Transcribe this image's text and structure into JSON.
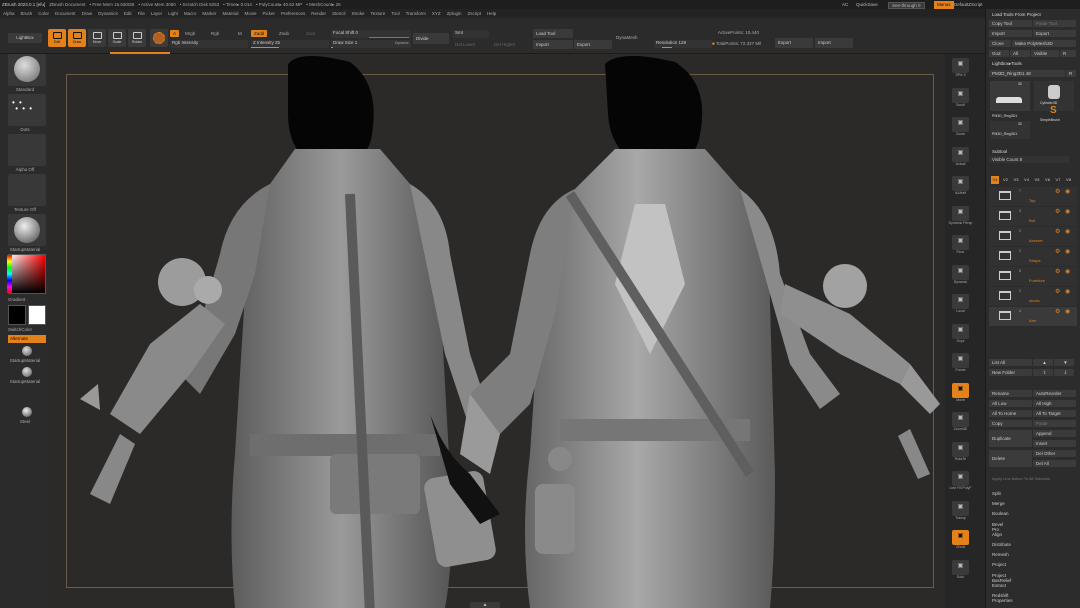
{
  "menubar": {
    "title": "ZBrush 2023.0.1 [efu]",
    "document": "ZBrush Document",
    "stats": [
      "• Free Mem 15.630GB",
      "• Active Mem 3050",
      "• Scratch Disk 8253",
      "• Timer▸ 0.014",
      "• PolyCount▸ 40.62 MP",
      "• MeshCount▸ 26"
    ],
    "ac": "AC",
    "quicksave": "QuickSave",
    "see_through": "See-through  0",
    "menus": "Menus",
    "script": "DefaultZScript",
    "menu_items": [
      "Alpha",
      "Brush",
      "Color",
      "Document",
      "Draw",
      "Dynamics",
      "Edit",
      "File",
      "Layer",
      "Light",
      "Macro",
      "Marker",
      "Material",
      "Movie",
      "Picker",
      "Preferences",
      "Render",
      "Stencil",
      "Stroke",
      "Texture",
      "Tool",
      "Transform",
      "XYZ",
      "Zplugin",
      "Zscript",
      "Help"
    ]
  },
  "shelf": {
    "lightbox": "LightBox",
    "tools": [
      {
        "label": "Edit",
        "active": true
      },
      {
        "label": "Draw",
        "active": true
      },
      {
        "label": "Move",
        "active": false
      },
      {
        "label": "Scale",
        "active": false
      },
      {
        "label": "Rotate",
        "active": false
      }
    ],
    "a": "A",
    "mrgb": "Mrgb",
    "rgb": "Rgb",
    "m": "M",
    "rgb_intensity": "Rgb Intensity",
    "zadd": "Zadd",
    "zsub": "Zsub",
    "zcut": "Zcut",
    "z_intensity": "Z Intensity 25",
    "focal_shift": "Focal Shift 0",
    "draw_size": "Draw Size 1",
    "dynamic": "Dynamic",
    "divide": "Divide",
    "smt": "Smt",
    "del_lower": "Del Lower",
    "del_higher": "Del Higher",
    "load_tool": "Load Tool",
    "import": "Import",
    "export": "Export",
    "dynamesh": "DynaMesh",
    "resolution": "Resolution 128",
    "active_points": "ActivePoints: 10,440",
    "total_points": "TotalPoints: 72.327 Mil",
    "export2": "Export",
    "import2": "Import"
  },
  "left": {
    "standard": "Standard",
    "dots": "Dots",
    "alpha_off": "Alpha Off",
    "texture_off": "Texture Off",
    "startup_material": "StartupMaterial",
    "gradient": "Gradient",
    "switch_color": "SwitchColor",
    "alternate": "Alternate",
    "startup_material2": "StartupMaterial",
    "startup_material3": "StartupMaterial",
    "steel": "Steel"
  },
  "rstrip": {
    "items": [
      "SPix 3",
      "Scroll",
      "Zoom",
      "Actual",
      "AAHalf",
      "Dynamic Persp",
      "Floor",
      "Dynamic",
      "Local",
      "Gxyz",
      "Frame",
      "Move",
      "Zoom3D",
      "RotaTe",
      "Line Fill PolyF",
      "Transp",
      "Ghost",
      "Solo"
    ]
  },
  "rpanel": {
    "load_tools": "Load Tools From Project",
    "copy_tool": "Copy Tool",
    "paste_tool": "Paste Tool",
    "import": "Import",
    "export": "Export",
    "clone": "Clone",
    "make_polymesh": "Make PolyMesh3D",
    "goz": "GoZ",
    "all": "All",
    "visible": "Visible",
    "r": "R",
    "lightbox_tools": "Lightbox▸Tools",
    "current_tool": "PM3D_Ring3D1",
    "current_tool_count": "48",
    "thumb_num1": "30",
    "thumb_num2": "30",
    "cylinder": "Cylinder3D",
    "simplebrush": "SimpleBrush",
    "pm3d1": "PM3D_Ring3D1",
    "pm3d2": "PM3D_Ring3D1",
    "subtool": "Subtool",
    "visible_count": "Visible Count 8",
    "vtabs": [
      "V1",
      "V2",
      "V3",
      "V4",
      "V5",
      "V6",
      "V7",
      "V8"
    ],
    "folders": [
      {
        "num": "7",
        "name": "Top"
      },
      {
        "num": "3",
        "name": "Bot"
      },
      {
        "num": "2",
        "name": "Acenter"
      },
      {
        "num": "2",
        "name": "Straps"
      },
      {
        "num": "5",
        "name": "Furniture"
      },
      {
        "num": "2",
        "name": "shoes"
      },
      {
        "num": "4",
        "name": "Arm"
      }
    ],
    "list_all": "List All",
    "new_folder": "New Folder",
    "rename": "Rename",
    "auto_reorder": "AutoReorder",
    "all_low": "All Low",
    "all_high": "All High",
    "all_to_home": "All To Home",
    "all_to_target": "All To Target",
    "copy": "Copy",
    "paste": "Paste",
    "duplicate": "Duplicate",
    "append": "Append",
    "insert": "Insert",
    "delete": "Delete",
    "del_other": "Del Other",
    "del_all": "Del All",
    "apply_line": "Apply Line Action To All Subtools",
    "plugins": [
      "Split",
      "Merge",
      "Boolean",
      "Bevel Pro",
      "Align",
      "Distribute",
      "Remesh",
      "Project",
      "Project BasRelief",
      "Extract",
      "Redshift Properties"
    ]
  }
}
